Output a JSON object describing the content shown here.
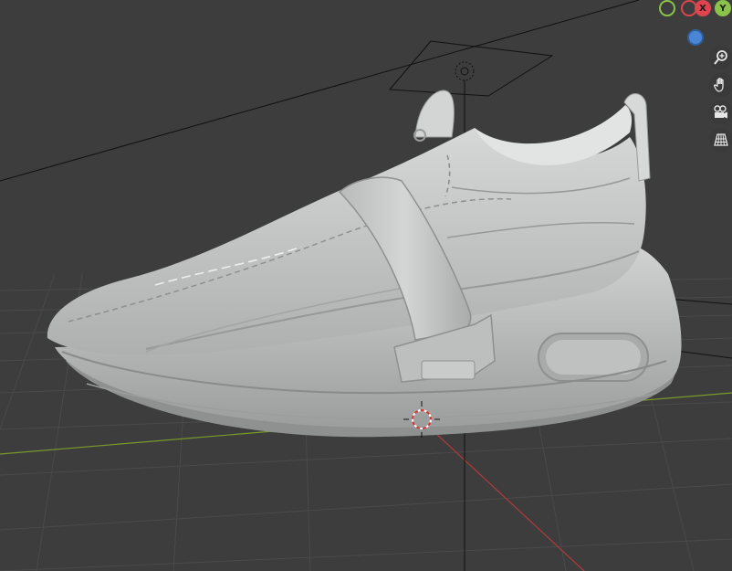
{
  "viewport": {
    "background": "#3d3d3d",
    "grid_color": "#4a4a4a",
    "x_axis_color": "#b23a3a",
    "y_axis_color": "#7a9a2a",
    "model_color": "#c8c9c9"
  },
  "navigation_gizmo": {
    "x_label": "X",
    "y_label": "Y",
    "x_color": "#e0454f",
    "y_color": "#8bc34a",
    "z_color": "#4b86d6"
  },
  "nav_controls": [
    {
      "name": "zoom",
      "icon": "magnifier-plus-icon"
    },
    {
      "name": "pan",
      "icon": "hand-icon"
    },
    {
      "name": "camera",
      "icon": "camera-icon"
    },
    {
      "name": "perspective",
      "icon": "grid-perspective-icon"
    }
  ]
}
